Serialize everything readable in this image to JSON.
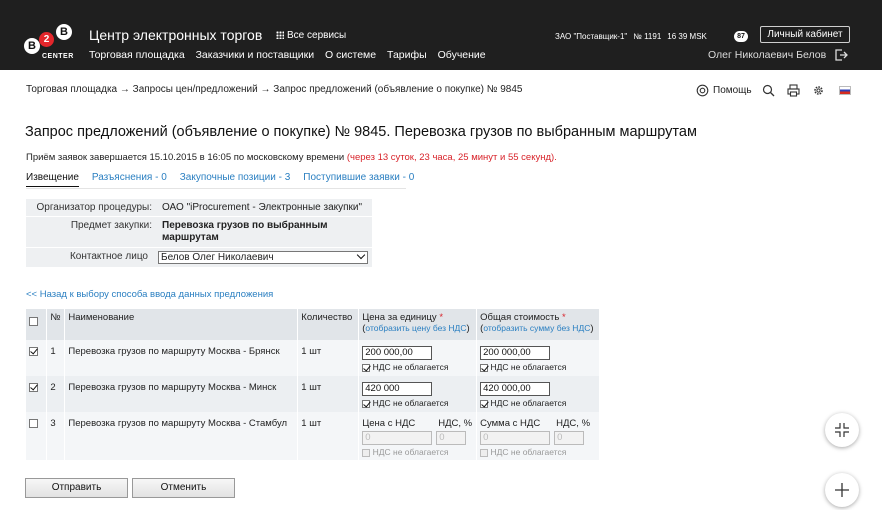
{
  "header": {
    "logo_letters": [
      "B",
      "2",
      "B"
    ],
    "logo_text": "CENTER",
    "site_title": "Центр электронных торгов",
    "all_services": "Все сервисы",
    "nav": [
      "Торговая площадка",
      "Заказчики и поставщики",
      "О системе",
      "Тарифы",
      "Обучение"
    ],
    "org_name": "ЗАО \"Поставщик-1\"",
    "org_number": "№ 1191",
    "time": "16 39 MSK",
    "notifications": "87",
    "cabinet_button": "Личный кабинет",
    "user_name": "Олег Николаевич Белов"
  },
  "breadcrumb": "Торговая площадка → Запросы цен/предложений → Запрос предложений (объявление о покупке) № 9845",
  "tools": {
    "help": "Помощь"
  },
  "page_title": "Запрос предложений (объявление о покупке) № 9845. Перевозка грузов по выбранным маршрутам",
  "deadline": {
    "text": "Приём заявок завершается 15.10.2015 в 16:05 по московскому времени",
    "remaining": "(через 13 суток, 23 часа, 25 минут и 55 секунд)."
  },
  "tabs": [
    "Извещение",
    "Разъяснения - 0",
    "Закупочные позиции - 3",
    "Поступившие заявки - 0"
  ],
  "info": {
    "organizer_label": "Организатор процедуры:",
    "organizer_value": "ОАО \"iProcurement - Электронные закупки\"",
    "subject_label": "Предмет закупки:",
    "subject_value": "Перевозка грузов по выбранным маршрутам",
    "contact_label": "Контактное лицо",
    "contact_value": "Белов Олег Николаевич"
  },
  "back_link": "<< Назад к выбору способа ввода данных предложения",
  "table": {
    "headers": {
      "num": "№",
      "name": "Наименование",
      "qty": "Количество",
      "price": "Цена за единицу",
      "price_link": "отобразить цену без НДС",
      "total": "Общая стоимость",
      "total_link": "отобразить сумму без НДС",
      "required_mark": "*"
    },
    "vat_exempt_label": "НДС не облагается",
    "price_vat_label": "Цена с НДС",
    "sum_vat_label": "Сумма с НДС",
    "vat_pct_label": "НДС, %",
    "disabled_placeholder": "0",
    "rows": [
      {
        "num": "1",
        "name": "Перевозка грузов по маршруту Москва - Брянск",
        "qty": "1 шт",
        "price": "200 000,00",
        "total": "200 000,00"
      },
      {
        "num": "2",
        "name": "Перевозка грузов по маршруту Москва - Минск",
        "qty": "1 шт",
        "price": "420 000",
        "total": "420 000,00"
      },
      {
        "num": "3",
        "name": "Перевозка грузов по маршруту Москва - Стамбул",
        "qty": "1 шт"
      }
    ]
  },
  "buttons": {
    "submit": "Отправить",
    "cancel": "Отменить"
  }
}
